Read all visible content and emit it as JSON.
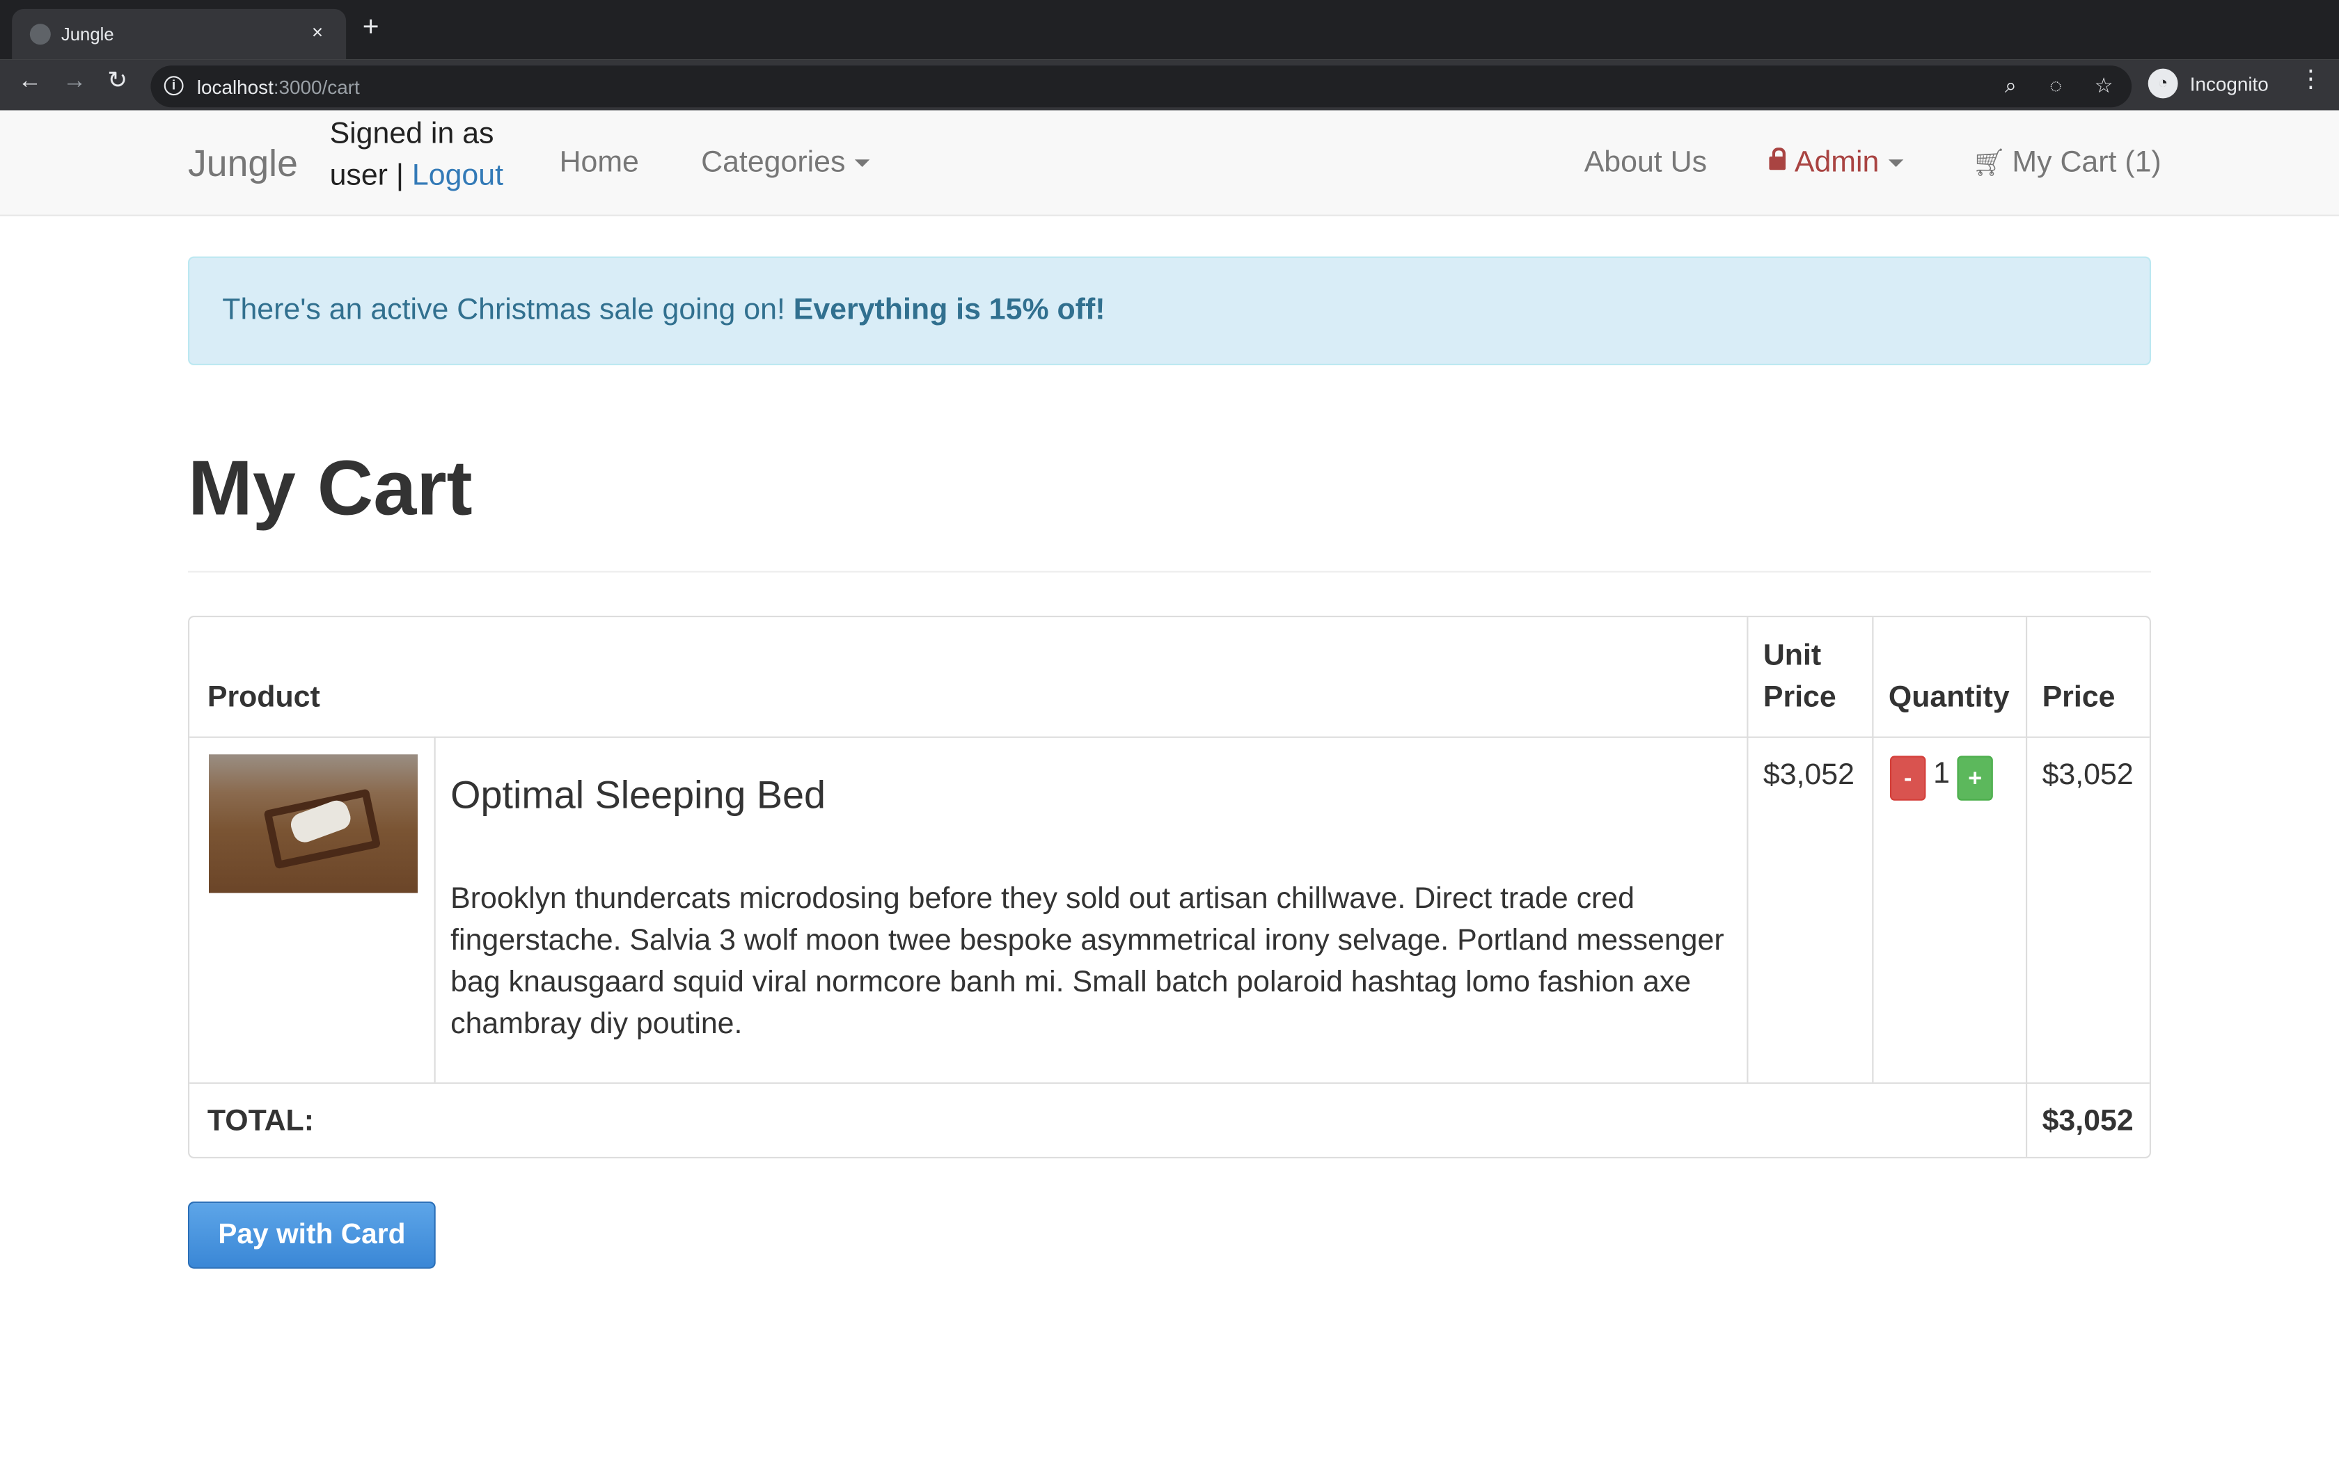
{
  "browser": {
    "tab_title": "Jungle",
    "tab_close": "×",
    "new_tab": "+",
    "url_host": "localhost",
    "url_path": ":3000/cart",
    "profile_label": "Incognito"
  },
  "navbar": {
    "brand": "Jungle",
    "signed_in_text": "Signed in as",
    "user_name": "user",
    "separator": "|",
    "logout": "Logout",
    "home": "Home",
    "categories": "Categories",
    "about": "About Us",
    "admin": "Admin",
    "cart": "My Cart (1)"
  },
  "alert": {
    "text": "There's an active Christmas sale going on! ",
    "bold": "Everything is 15% off!"
  },
  "page_title": "My Cart",
  "table": {
    "headers": {
      "product": "Product",
      "unit_price_line1": "Unit",
      "unit_price_line2": "Price",
      "quantity": "Quantity",
      "price": "Price"
    },
    "rows": [
      {
        "name": "Optimal Sleeping Bed",
        "description": "Brooklyn thundercats microdosing before they sold out artisan chillwave. Direct trade cred fingerstache. Salvia 3 wolf moon twee bespoke asymmetrical irony selvage. Portland messenger bag knausgaard squid viral normcore banh mi. Small batch polaroid hashtag lomo fashion axe chambray diy poutine.",
        "unit_price": "$3,052",
        "quantity": "1",
        "minus_label": "-",
        "plus_label": "+",
        "price": "$3,052"
      }
    ],
    "total_label": "TOTAL:",
    "total_value": "$3,052"
  },
  "pay_button": "Pay with Card",
  "colors": {
    "link": "#337ab7",
    "danger": "#d9534f",
    "success": "#5cb85c",
    "admin": "#a94442",
    "alert_bg": "#d9edf7",
    "alert_text": "#31708f"
  }
}
